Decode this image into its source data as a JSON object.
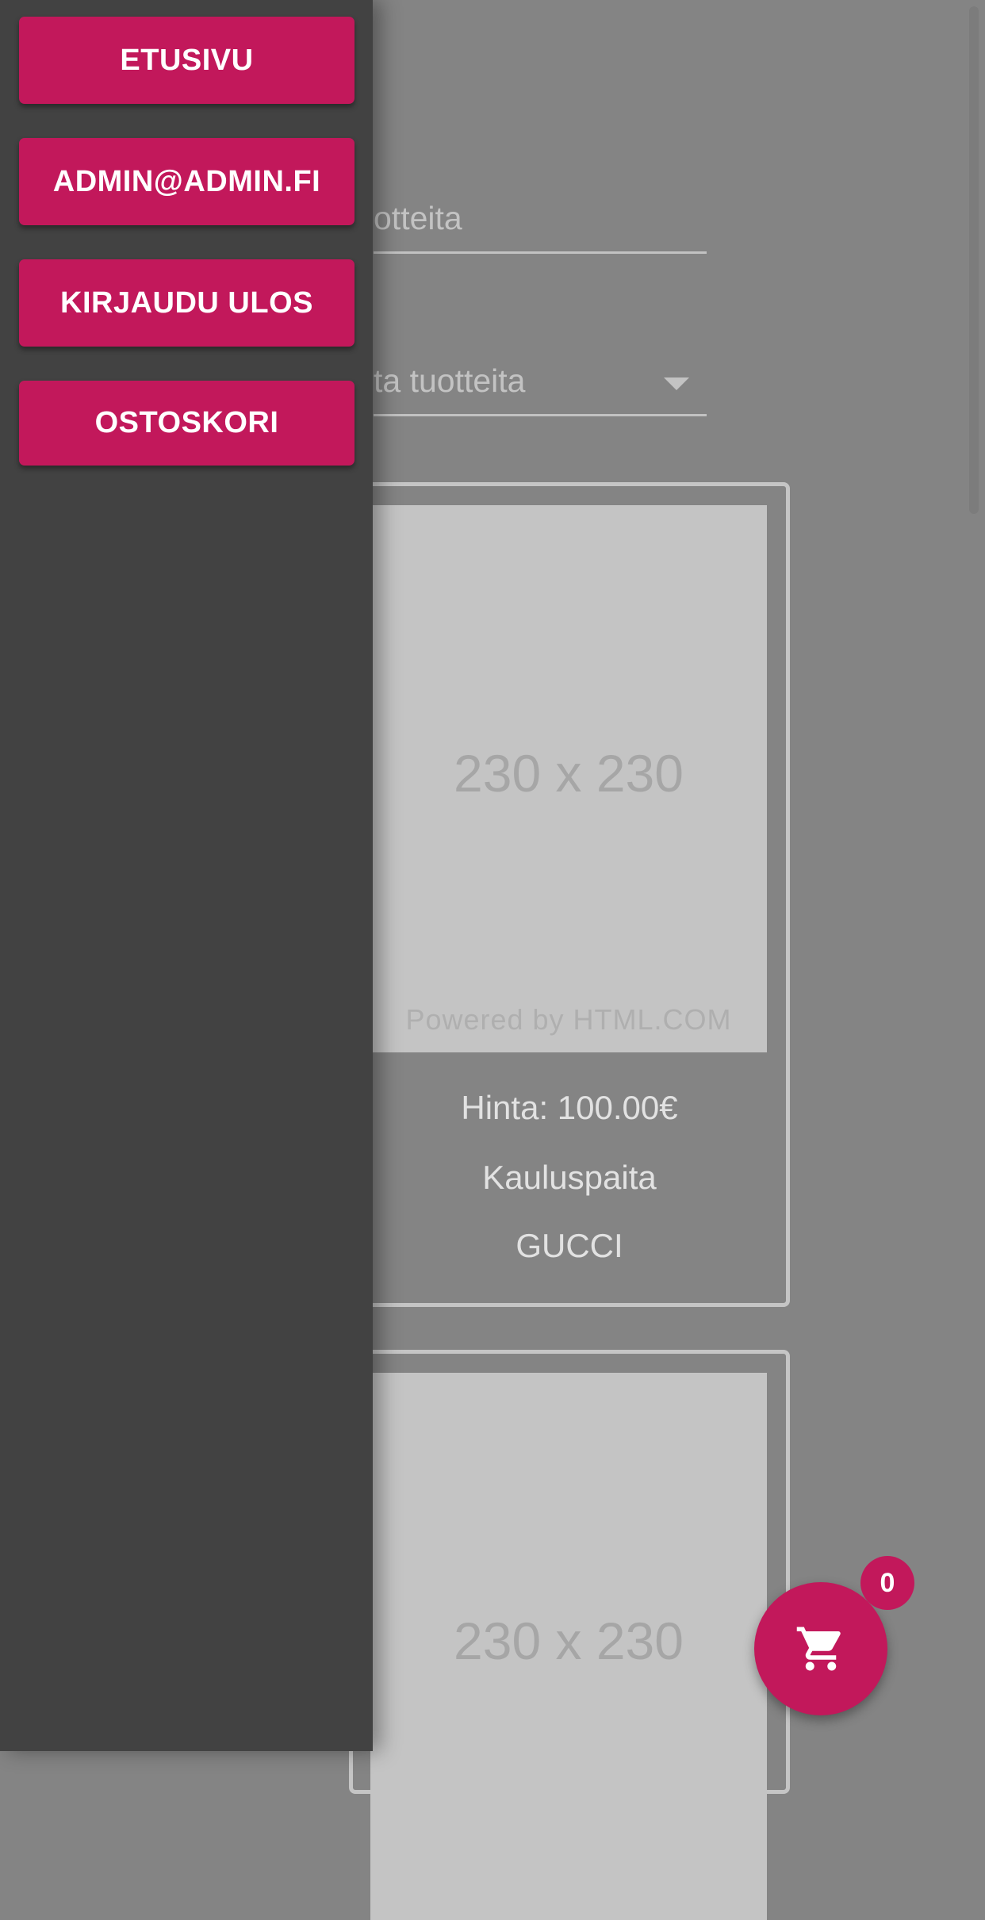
{
  "drawer": {
    "items": [
      {
        "label": "ETUSIVU"
      },
      {
        "label": "ADMIN@ADMIN.FI"
      },
      {
        "label": "KIRJAUDU ULOS"
      },
      {
        "label": "OSTOSKORI"
      }
    ]
  },
  "search": {
    "visible_text": "otteita"
  },
  "filter": {
    "visible_text": "ta tuotteita"
  },
  "products": [
    {
      "image_text": "230 x 230",
      "image_footer": "Powered by HTML.COM",
      "price": "Hinta: 100.00€",
      "name": "Kauluspaita",
      "brand": "GUCCI"
    },
    {
      "image_text": "230 x 230"
    }
  ],
  "cart": {
    "count": "0",
    "icon": "shopping-cart-icon"
  },
  "colors": {
    "accent": "#c2185b",
    "drawer_bg": "#424242",
    "scrim_bg": "#848484"
  }
}
